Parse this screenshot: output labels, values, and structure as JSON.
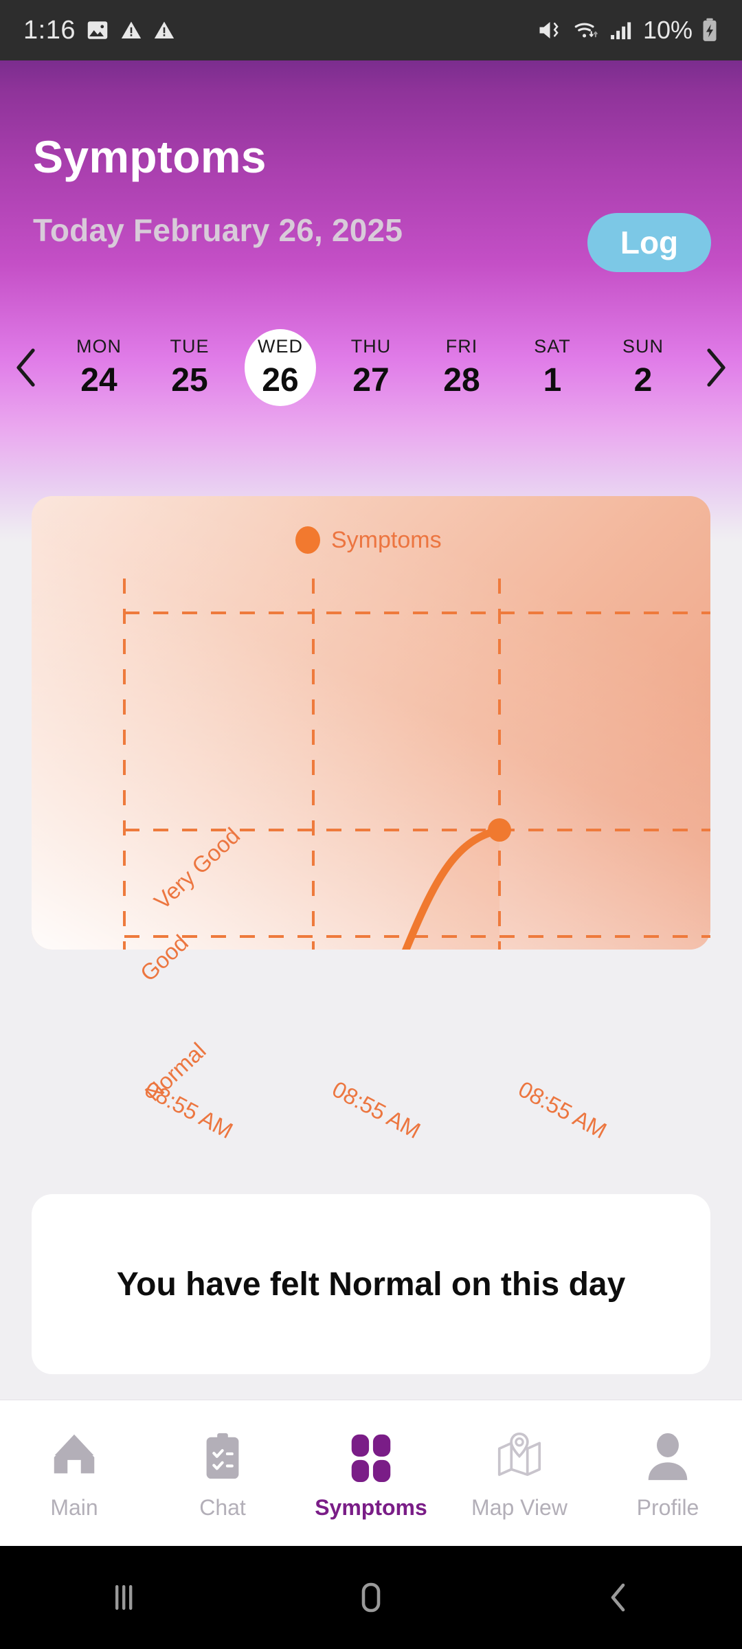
{
  "statusbar": {
    "time": "1:16",
    "battery_percent": "10%",
    "icons": [
      "image-icon",
      "warning-icon",
      "warning-icon",
      "mute-icon",
      "wifi-icon",
      "signal-icon",
      "battery-charging-icon"
    ]
  },
  "header": {
    "title": "Symptoms",
    "subtitle": "Today February 26, 2025",
    "log_label": "Log"
  },
  "weekstrip": {
    "prev_label": "‹",
    "next_label": "›",
    "days": [
      {
        "dow": "MON",
        "num": "24",
        "selected": false
      },
      {
        "dow": "TUE",
        "num": "25",
        "selected": false
      },
      {
        "dow": "WED",
        "num": "26",
        "selected": true
      },
      {
        "dow": "THU",
        "num": "27",
        "selected": false
      },
      {
        "dow": "FRI",
        "num": "28",
        "selected": false
      },
      {
        "dow": "SAT",
        "num": "1",
        "selected": false
      },
      {
        "dow": "SUN",
        "num": "2",
        "selected": false
      }
    ]
  },
  "chart_data": {
    "type": "line",
    "title": "",
    "legend": [
      "Symptoms"
    ],
    "legend_position": "top-center",
    "series": [
      {
        "name": "Symptoms",
        "values": [
          "Normal",
          "Normal",
          "Very Good"
        ]
      }
    ],
    "x": [
      "08:55 AM",
      "08:55 AM",
      "08:55 AM"
    ],
    "xlabel": "",
    "ylabel": "",
    "ytick_labels": [
      "Normal",
      "Good",
      "Very Good"
    ],
    "ylevels": [
      1,
      2,
      3
    ],
    "numeric_values": [
      1,
      1,
      3
    ],
    "ylim": [
      1,
      3
    ],
    "grid": true,
    "line_color": "#f0792f",
    "point_color": "#f0792f",
    "label_color": "#ec7640"
  },
  "message": {
    "text": "You have felt Normal on this day"
  },
  "bottomnav": {
    "items": [
      {
        "label": "Main",
        "icon": "home-icon",
        "active": false
      },
      {
        "label": "Chat",
        "icon": "clipboard-check-icon",
        "active": false
      },
      {
        "label": "Symptoms",
        "icon": "grid-squares-icon",
        "active": true
      },
      {
        "label": "Map View",
        "icon": "map-pin-icon",
        "active": false
      },
      {
        "label": "Profile",
        "icon": "person-icon",
        "active": false
      }
    ],
    "active_color": "#7a1d87",
    "inactive_color": "#b3afb8"
  },
  "androidnav": {
    "buttons": [
      "recents-icon",
      "home-icon",
      "back-icon"
    ]
  }
}
